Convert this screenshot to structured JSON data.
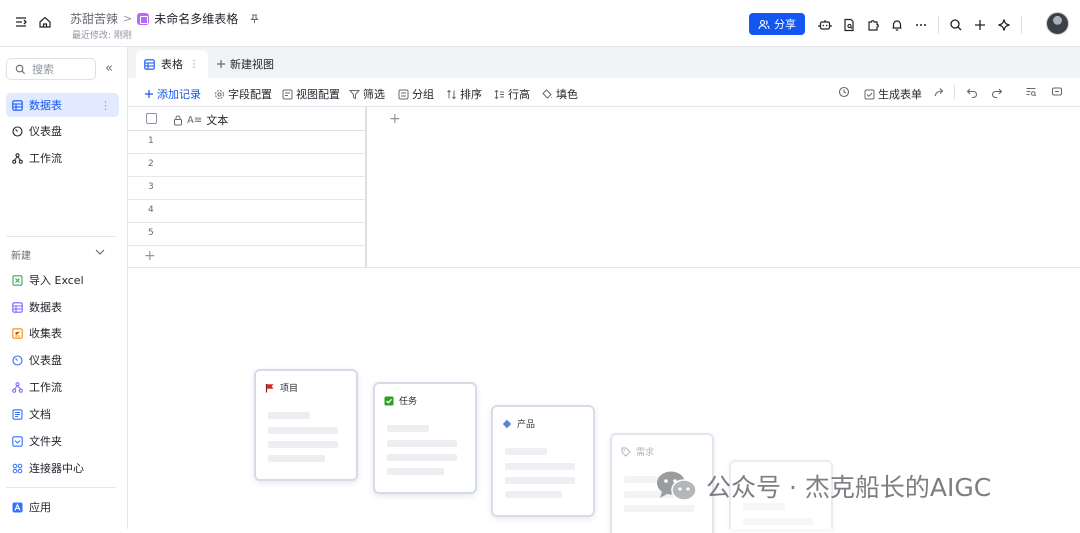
{
  "breadcrumb": {
    "user": "苏甜苦辣",
    "separator": ">",
    "doc_title": "未命名多维表格",
    "last_modified": "最近修改: 刚刚"
  },
  "header": {
    "share_label": "分享"
  },
  "sidebar": {
    "search_placeholder": "搜索",
    "collapse_glyph": "«",
    "items": [
      {
        "label": "数据表",
        "icon": "table-icon",
        "active": true
      },
      {
        "label": "仪表盘",
        "icon": "dashboard-icon"
      },
      {
        "label": "工作流",
        "icon": "workflow-icon"
      }
    ],
    "new_section_label": "新建",
    "new_items": [
      {
        "label": "导入 Excel",
        "icon": "excel-icon",
        "color": "#34a853"
      },
      {
        "label": "数据表",
        "icon": "table-icon",
        "color": "#7b61ff"
      },
      {
        "label": "收集表",
        "icon": "form-icon",
        "color": "#ff8800"
      },
      {
        "label": "仪表盘",
        "icon": "dashboard-icon",
        "color": "#3370ff"
      },
      {
        "label": "工作流",
        "icon": "workflow-icon",
        "color": "#7b61ff"
      },
      {
        "label": "文档",
        "icon": "doc-icon",
        "color": "#3370ff"
      },
      {
        "label": "文件夹",
        "icon": "folder-icon",
        "color": "#3370ff"
      },
      {
        "label": "连接器中心",
        "icon": "connector-icon",
        "color": "#3370ff"
      }
    ],
    "app_label": "应用"
  },
  "tabs": {
    "current": "表格",
    "new_view": "新建视图"
  },
  "toolbar": {
    "add_record": "添加记录",
    "field_config": "字段配置",
    "view_config": "视图配置",
    "filter": "筛选",
    "group": "分组",
    "sort": "排序",
    "row_height": "行高",
    "fill_color": "填色",
    "generate_form": "生成表单"
  },
  "grid": {
    "column_header": "文本",
    "row_numbers": [
      "1",
      "2",
      "3",
      "4",
      "5"
    ]
  },
  "cards": [
    {
      "title": "项目",
      "icon": "flag-icon"
    },
    {
      "title": "任务",
      "icon": "checkbox-icon"
    },
    {
      "title": "产品",
      "icon": "diamond-icon"
    },
    {
      "title": "需求",
      "icon": "tag-icon"
    }
  ],
  "watermark": "公众号 · 杰克船长的AIGC",
  "colors": {
    "accent": "#1456f0",
    "active_bg": "#e1eaff",
    "border": "#e5e6eb"
  }
}
